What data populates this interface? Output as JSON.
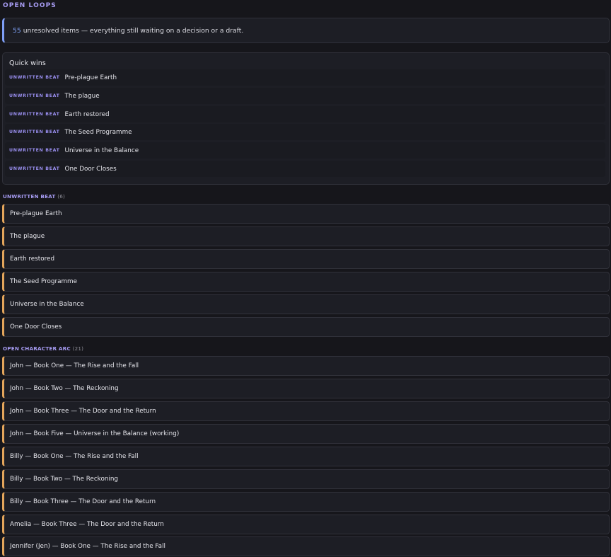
{
  "page": {
    "title": "OPEN LOOPS"
  },
  "summary": {
    "count": "55",
    "text": "unresolved items — everything still waiting on a decision or a draft."
  },
  "quick_wins": {
    "title": "Quick wins",
    "items": [
      {
        "tag": "UNWRITTEN BEAT",
        "label": "Pre-plague Earth"
      },
      {
        "tag": "UNWRITTEN BEAT",
        "label": "The plague"
      },
      {
        "tag": "UNWRITTEN BEAT",
        "label": "Earth restored"
      },
      {
        "tag": "UNWRITTEN BEAT",
        "label": "The Seed Programme"
      },
      {
        "tag": "UNWRITTEN BEAT",
        "label": "Universe in the Balance"
      },
      {
        "tag": "UNWRITTEN BEAT",
        "label": "One Door Closes"
      }
    ]
  },
  "sections": [
    {
      "title": "UNWRITTEN BEAT",
      "count": "(6)",
      "items": [
        {
          "label": "Pre-plague Earth"
        },
        {
          "label": "The plague"
        },
        {
          "label": "Earth restored"
        },
        {
          "label": "The Seed Programme"
        },
        {
          "label": "Universe in the Balance"
        },
        {
          "label": "One Door Closes"
        }
      ]
    },
    {
      "title": "OPEN CHARACTER ARC",
      "count": "(21)",
      "items": [
        {
          "label": "John — Book One — The Rise and the Fall"
        },
        {
          "label": "John — Book Two — The Reckoning"
        },
        {
          "label": "John — Book Three — The Door and the Return"
        },
        {
          "label": "John — Book Five — Universe in the Balance (working)"
        },
        {
          "label": "Billy — Book One — The Rise and the Fall"
        },
        {
          "label": "Billy — Book Two — The Reckoning"
        },
        {
          "label": "Billy — Book Three — The Door and the Return"
        },
        {
          "label": "Amelia — Book Three — The Door and the Return"
        },
        {
          "label": "Jennifer (Jen) — Book One — The Rise and the Fall"
        }
      ]
    }
  ],
  "colors": {
    "accent": "#a79cf3",
    "summary_accent": "#7e9ef6",
    "item_accent": "#e3a55b",
    "background": "#16161b"
  }
}
